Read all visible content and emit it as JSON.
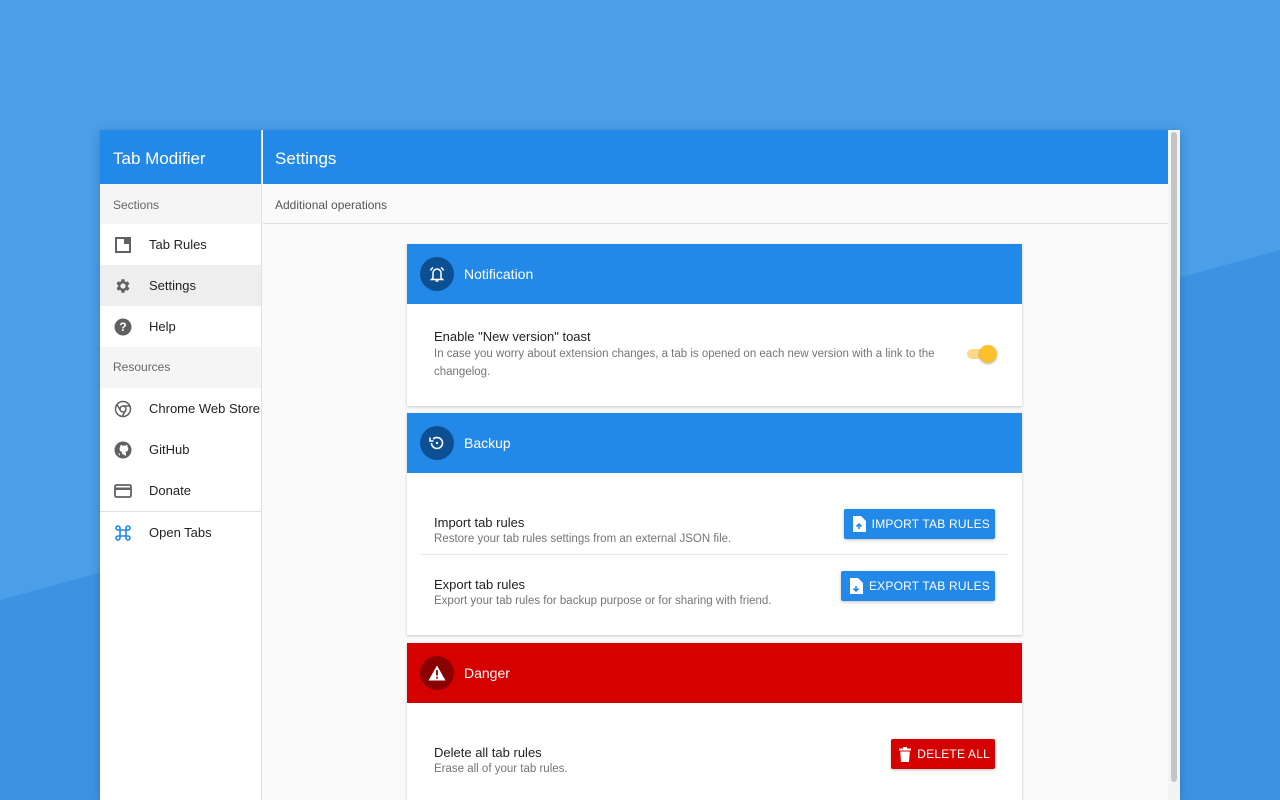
{
  "colors": {
    "primary": "#2389e8",
    "danger": "#d50000",
    "toggle_on": "#fbc02d",
    "background": "#4a9fe8"
  },
  "sidebar": {
    "app_title": "Tab Modifier",
    "sections_label": "Sections",
    "resources_label": "Resources",
    "items": [
      {
        "label": "Tab Rules",
        "icon": "tab-icon"
      },
      {
        "label": "Settings",
        "icon": "gear-icon"
      },
      {
        "label": "Help",
        "icon": "help-icon"
      }
    ],
    "resources": [
      {
        "label": "Chrome Web Store",
        "icon": "chrome-icon"
      },
      {
        "label": "GitHub",
        "icon": "github-icon"
      },
      {
        "label": "Donate",
        "icon": "credit-card-icon"
      }
    ],
    "open_tabs": {
      "label": "Open Tabs",
      "icon": "command-icon"
    }
  },
  "header": {
    "title": "Settings",
    "subtitle": "Additional operations"
  },
  "cards": {
    "notification": {
      "title": "Notification",
      "row_title": "Enable \"New version\" toast",
      "row_desc": "In case you worry about extension changes, a tab is opened on each new version with a link to the changelog.",
      "toggle_on": true
    },
    "backup": {
      "title": "Backup",
      "import_title": "Import tab rules",
      "import_desc": "Restore your tab rules settings from an external JSON file.",
      "import_button": "IMPORT TAB RULES",
      "export_title": "Export tab rules",
      "export_desc": "Export your tab rules for backup purpose or for sharing with friend.",
      "export_button": "EXPORT TAB RULES"
    },
    "danger": {
      "title": "Danger",
      "delete_title": "Delete all tab rules",
      "delete_desc": "Erase all of your tab rules.",
      "delete_button": "DELETE ALL"
    }
  }
}
